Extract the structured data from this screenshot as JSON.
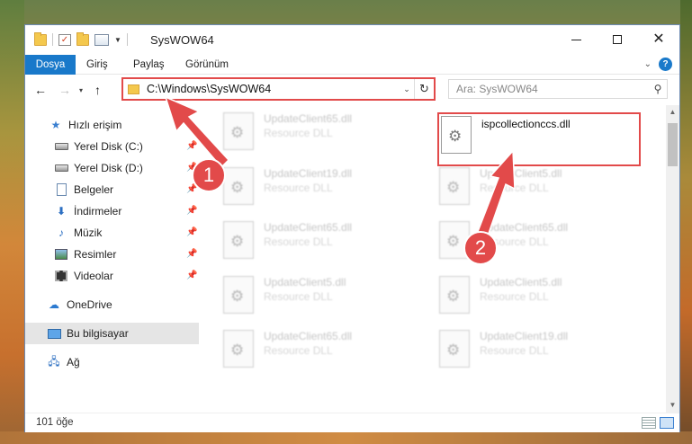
{
  "window": {
    "title": "SysWOW64",
    "colors": {
      "accent": "#1979ca",
      "highlight": "#e24a4a"
    }
  },
  "ribbon": {
    "tabs": [
      {
        "label": "Dosya"
      },
      {
        "label": "Giriş"
      },
      {
        "label": "Paylaş"
      },
      {
        "label": "Görünüm"
      }
    ],
    "help_label": "?"
  },
  "address": {
    "path": "C:\\Windows\\SysWOW64",
    "search_placeholder": "Ara: SysWOW64"
  },
  "sidebar": {
    "items": [
      {
        "label": "Hızlı erişim",
        "icon": "star-icon"
      },
      {
        "label": "Yerel Disk (C:)",
        "icon": "drive-icon",
        "pinned": true
      },
      {
        "label": "Yerel Disk (D:)",
        "icon": "drive-icon",
        "pinned": true
      },
      {
        "label": "Belgeler",
        "icon": "documents-icon",
        "pinned": true
      },
      {
        "label": "İndirmeler",
        "icon": "download-icon",
        "pinned": true
      },
      {
        "label": "Müzik",
        "icon": "music-icon",
        "pinned": true
      },
      {
        "label": "Resimler",
        "icon": "pictures-icon",
        "pinned": true
      },
      {
        "label": "Videolar",
        "icon": "videos-icon",
        "pinned": true
      },
      {
        "label": "OneDrive",
        "icon": "cloud-icon"
      },
      {
        "label": "Bu bilgisayar",
        "icon": "computer-icon",
        "selected": true
      },
      {
        "label": "Ağ",
        "icon": "network-icon"
      }
    ]
  },
  "files": [
    {
      "name": "UpdateClient65.dll",
      "type": "Resource DLL"
    },
    {
      "name": "ispcollectionccs.dll",
      "type": ""
    },
    {
      "name": "UpdateClient19.dll",
      "type": "Resource DLL"
    },
    {
      "name": "UpdateClient5.dll",
      "type": "Resource DLL"
    },
    {
      "name": "UpdateClient65.dll",
      "type": "Resource DLL"
    },
    {
      "name": "UpdateClient65.dll",
      "type": "Resource DLL"
    },
    {
      "name": "UpdateClient5.dll",
      "type": "Resource DLL"
    },
    {
      "name": "UpdateClient5.dll",
      "type": "Resource DLL"
    },
    {
      "name": "UpdateClient65.dll",
      "type": "Resource DLL"
    },
    {
      "name": "UpdateClient19.dll",
      "type": "Resource DLL"
    }
  ],
  "status": {
    "item_count": "101 öğe"
  },
  "callouts": [
    "1",
    "2"
  ]
}
